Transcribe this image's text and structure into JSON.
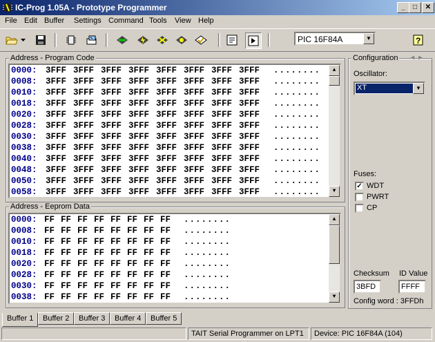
{
  "window": {
    "title": "IC-Prog 1.05A - Prototype Programmer",
    "minimize": "_",
    "maximize": "□",
    "close": "✕"
  },
  "menu": [
    "File",
    "Edit",
    "Buffer",
    "Settings",
    "Command",
    "Tools",
    "View",
    "Help"
  ],
  "toolbar": {
    "device": "PIC 16F84A",
    "icons": [
      "open-folder-icon",
      "dropdown-arrow-icon",
      "save-icon",
      "chip-config-icon",
      "hardware-setup-icon",
      "read-chip-icon",
      "program-chip-icon",
      "erase-chip-icon",
      "verify-chip-icon",
      "blank-check-icon",
      "assembler-view-icon",
      "hex-view-icon",
      "help-icon"
    ]
  },
  "program_code": {
    "label": "Address - Program Code",
    "rows": [
      {
        "addr": "0000:",
        "cells": [
          "3FFF",
          "3FFF",
          "3FFF",
          "3FFF",
          "3FFF",
          "3FFF",
          "3FFF",
          "3FFF"
        ],
        "ascii": "........"
      },
      {
        "addr": "0008:",
        "cells": [
          "3FFF",
          "3FFF",
          "3FFF",
          "3FFF",
          "3FFF",
          "3FFF",
          "3FFF",
          "3FFF"
        ],
        "ascii": "........"
      },
      {
        "addr": "0010:",
        "cells": [
          "3FFF",
          "3FFF",
          "3FFF",
          "3FFF",
          "3FFF",
          "3FFF",
          "3FFF",
          "3FFF"
        ],
        "ascii": "........"
      },
      {
        "addr": "0018:",
        "cells": [
          "3FFF",
          "3FFF",
          "3FFF",
          "3FFF",
          "3FFF",
          "3FFF",
          "3FFF",
          "3FFF"
        ],
        "ascii": "........"
      },
      {
        "addr": "0020:",
        "cells": [
          "3FFF",
          "3FFF",
          "3FFF",
          "3FFF",
          "3FFF",
          "3FFF",
          "3FFF",
          "3FFF"
        ],
        "ascii": "........"
      },
      {
        "addr": "0028:",
        "cells": [
          "3FFF",
          "3FFF",
          "3FFF",
          "3FFF",
          "3FFF",
          "3FFF",
          "3FFF",
          "3FFF"
        ],
        "ascii": "........"
      },
      {
        "addr": "0030:",
        "cells": [
          "3FFF",
          "3FFF",
          "3FFF",
          "3FFF",
          "3FFF",
          "3FFF",
          "3FFF",
          "3FFF"
        ],
        "ascii": "........"
      },
      {
        "addr": "0038:",
        "cells": [
          "3FFF",
          "3FFF",
          "3FFF",
          "3FFF",
          "3FFF",
          "3FFF",
          "3FFF",
          "3FFF"
        ],
        "ascii": "........"
      },
      {
        "addr": "0040:",
        "cells": [
          "3FFF",
          "3FFF",
          "3FFF",
          "3FFF",
          "3FFF",
          "3FFF",
          "3FFF",
          "3FFF"
        ],
        "ascii": "........"
      },
      {
        "addr": "0048:",
        "cells": [
          "3FFF",
          "3FFF",
          "3FFF",
          "3FFF",
          "3FFF",
          "3FFF",
          "3FFF",
          "3FFF"
        ],
        "ascii": "........"
      },
      {
        "addr": "0050:",
        "cells": [
          "3FFF",
          "3FFF",
          "3FFF",
          "3FFF",
          "3FFF",
          "3FFF",
          "3FFF",
          "3FFF"
        ],
        "ascii": "........"
      },
      {
        "addr": "0058:",
        "cells": [
          "3FFF",
          "3FFF",
          "3FFF",
          "3FFF",
          "3FFF",
          "3FFF",
          "3FFF",
          "3FFF"
        ],
        "ascii": "........"
      }
    ]
  },
  "eeprom": {
    "label": "Address - Eeprom Data",
    "rows": [
      {
        "addr": "0000:",
        "cells": [
          "FF",
          "FF",
          "FF",
          "FF",
          "FF",
          "FF",
          "FF",
          "FF"
        ],
        "ascii": "........"
      },
      {
        "addr": "0008:",
        "cells": [
          "FF",
          "FF",
          "FF",
          "FF",
          "FF",
          "FF",
          "FF",
          "FF"
        ],
        "ascii": "........"
      },
      {
        "addr": "0010:",
        "cells": [
          "FF",
          "FF",
          "FF",
          "FF",
          "FF",
          "FF",
          "FF",
          "FF"
        ],
        "ascii": "........"
      },
      {
        "addr": "0018:",
        "cells": [
          "FF",
          "FF",
          "FF",
          "FF",
          "FF",
          "FF",
          "FF",
          "FF"
        ],
        "ascii": "........"
      },
      {
        "addr": "0020:",
        "cells": [
          "FF",
          "FF",
          "FF",
          "FF",
          "FF",
          "FF",
          "FF",
          "FF"
        ],
        "ascii": "........"
      },
      {
        "addr": "0028:",
        "cells": [
          "FF",
          "FF",
          "FF",
          "FF",
          "FF",
          "FF",
          "FF",
          "FF"
        ],
        "ascii": "........"
      },
      {
        "addr": "0030:",
        "cells": [
          "FF",
          "FF",
          "FF",
          "FF",
          "FF",
          "FF",
          "FF",
          "FF"
        ],
        "ascii": "........"
      },
      {
        "addr": "0038:",
        "cells": [
          "FF",
          "FF",
          "FF",
          "FF",
          "FF",
          "FF",
          "FF",
          "FF"
        ],
        "ascii": "........"
      }
    ]
  },
  "config": {
    "label": "Configuration",
    "oscillator_label": "Oscillator:",
    "oscillator_value": "XT",
    "fuses_label": "Fuses:",
    "fuses": [
      {
        "name": "WDT",
        "checked": true
      },
      {
        "name": "PWRT",
        "checked": false
      },
      {
        "name": "CP",
        "checked": false
      }
    ],
    "checksum_label": "Checksum",
    "checksum_value": "3BFD",
    "id_label": "ID Value",
    "id_value": "FFFF",
    "config_word": "Config word : 3FFDh"
  },
  "tabs": [
    "Buffer 1",
    "Buffer 2",
    "Buffer 3",
    "Buffer 4",
    "Buffer 5"
  ],
  "status": {
    "empty": "",
    "programmer": "TAIT Serial Programmer on LPT1",
    "device": "Device: PIC 16F84A  (104)"
  }
}
